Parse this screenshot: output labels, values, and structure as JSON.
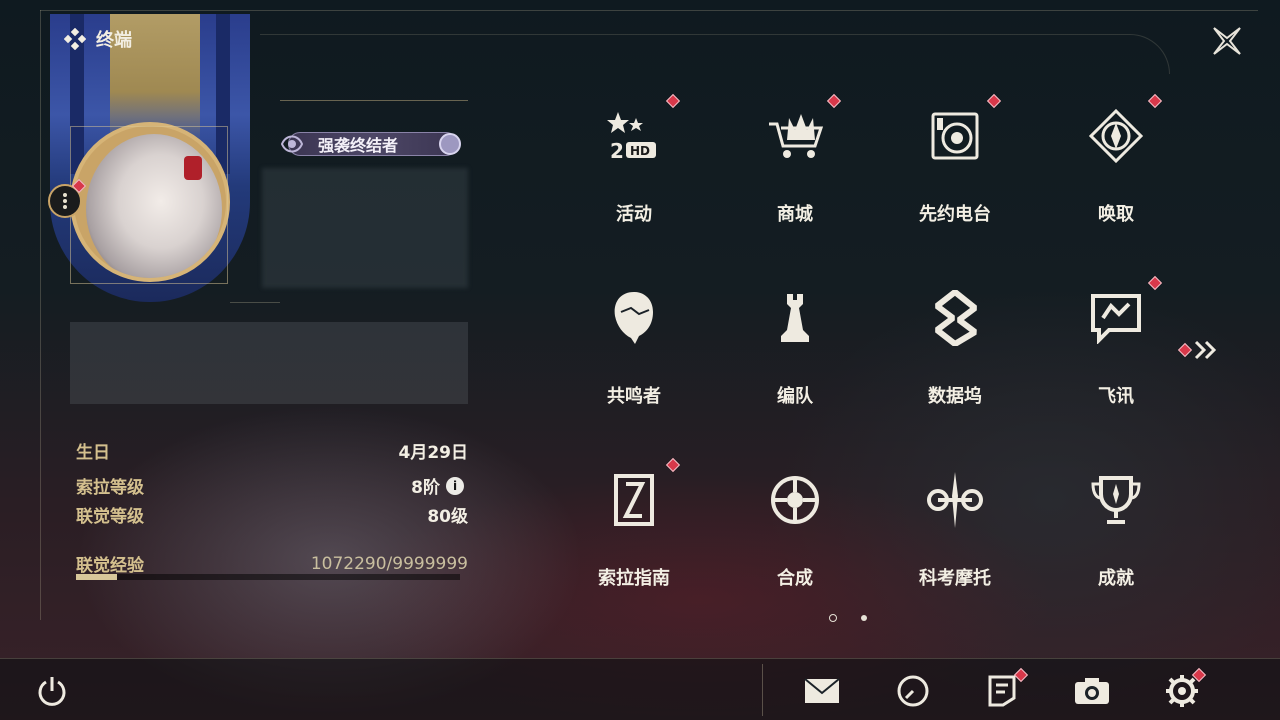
{
  "window": {
    "title": "终端"
  },
  "profile": {
    "title_badge": "强袭终结者",
    "birthday_label": "生日",
    "birthday_value": "4月29日",
    "sola_level_label": "索拉等级",
    "sola_level_value": "8阶",
    "union_level_label": "联觉等级",
    "union_level_value": "80级",
    "union_exp_label": "联觉经验",
    "union_exp_value": "1072290/9999999",
    "union_exp_progress": 0.107
  },
  "menu": {
    "items": [
      {
        "label": "活动",
        "icon": "activity-icon",
        "badge": true
      },
      {
        "label": "商城",
        "icon": "shop-icon",
        "badge": true
      },
      {
        "label": "先约电台",
        "icon": "radio-icon",
        "badge": true
      },
      {
        "label": "唤取",
        "icon": "convene-icon",
        "badge": true
      },
      {
        "label": "共鸣者",
        "icon": "resonator-icon",
        "badge": false
      },
      {
        "label": "编队",
        "icon": "team-icon",
        "badge": false
      },
      {
        "label": "数据坞",
        "icon": "data-dock-icon",
        "badge": false
      },
      {
        "label": "飞讯",
        "icon": "message-icon",
        "badge": true
      },
      {
        "label": "索拉指南",
        "icon": "guide-icon",
        "badge": true
      },
      {
        "label": "合成",
        "icon": "synthesis-icon",
        "badge": false
      },
      {
        "label": "科考摩托",
        "icon": "motorbike-icon",
        "badge": false
      },
      {
        "label": "成就",
        "icon": "achievement-icon",
        "badge": false
      }
    ],
    "page_count": 2,
    "current_page": 1
  },
  "bottom_bar": {
    "items": [
      "power-icon",
      "mail-icon",
      "clock-icon",
      "notice-icon",
      "camera-icon",
      "settings-icon"
    ]
  },
  "colors": {
    "accent_gold": "#d4c08e",
    "badge_red": "#d8384a"
  }
}
